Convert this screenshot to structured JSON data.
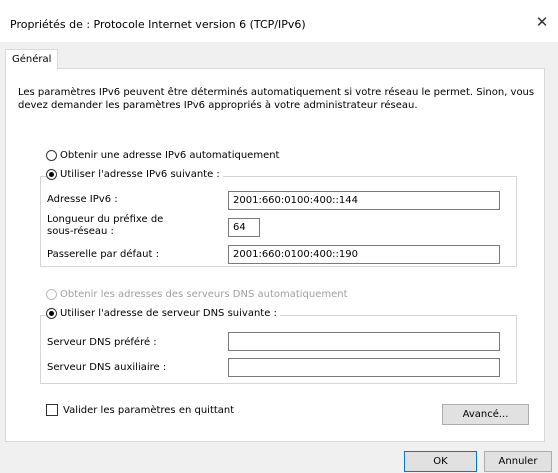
{
  "window": {
    "title": "Propriétés de : Protocole Internet version 6 (TCP/IPv6)",
    "close_glyph": "✕"
  },
  "tabs": [
    {
      "label": "Général"
    }
  ],
  "description": "Les paramètres IPv6 peuvent être déterminés automatiquement si votre réseau le permet. Sinon, vous devez demander les paramètres IPv6 appropriés à votre administrateur réseau.",
  "ip": {
    "auto_label": "Obtenir une adresse IPv6 automatiquement",
    "manual_label": "Utiliser l'adresse IPv6 suivante :",
    "address_label": "Adresse IPv6 :",
    "address_value": "2001:660:0100:400::144",
    "prefix_label_1": "Longueur du préfixe de",
    "prefix_label_2": "sous-réseau :",
    "prefix_value": "64",
    "gateway_label": "Passerelle par défaut :",
    "gateway_value": "2001:660:0100:400::190"
  },
  "dns": {
    "auto_label": "Obtenir les adresses des serveurs DNS automatiquement",
    "manual_label": "Utiliser l'adresse de serveur DNS suivante :",
    "preferred_label": "Serveur DNS préféré :",
    "preferred_value": "",
    "alternate_label": "Serveur DNS auxiliaire :",
    "alternate_value": ""
  },
  "validate_label": "Valider les paramètres en quittant",
  "buttons": {
    "advanced": "Avancé...",
    "ok": "OK",
    "cancel": "Annuler"
  }
}
